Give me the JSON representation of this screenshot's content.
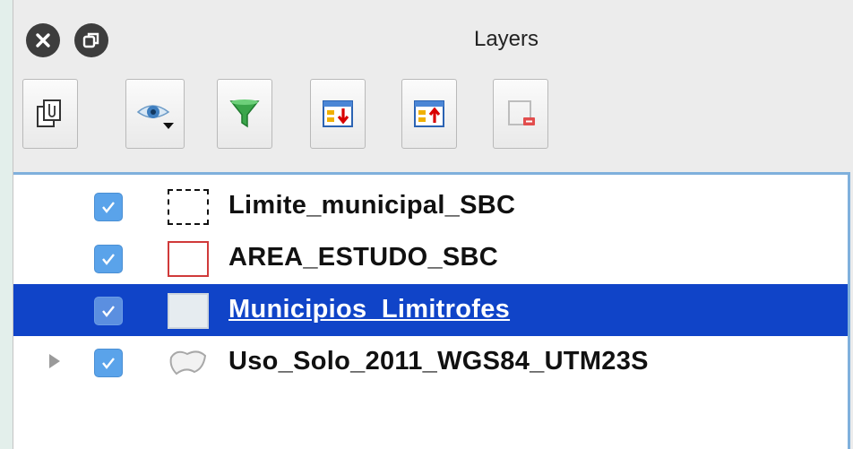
{
  "window": {
    "title": "Layers"
  },
  "toolbar": {
    "buttons": [
      {
        "name": "add-group-button",
        "icon": "add-group-icon"
      },
      {
        "name": "manage-visibility-button",
        "icon": "eye-icon"
      },
      {
        "name": "filter-legend-button",
        "icon": "funnel-icon"
      },
      {
        "name": "expand-all-button",
        "icon": "expand-all-icon"
      },
      {
        "name": "collapse-all-button",
        "icon": "collapse-all-icon"
      },
      {
        "name": "remove-layer-button",
        "icon": "remove-layer-icon"
      }
    ]
  },
  "layers": [
    {
      "label": "Limite_municipal_SBC",
      "checked": true,
      "symbol": "dashed-square",
      "expandable": false,
      "selected": false
    },
    {
      "label": "AREA_ESTUDO_SBC",
      "checked": true,
      "symbol": "red-outline-square",
      "expandable": false,
      "selected": false
    },
    {
      "label": "Municipios_Limitrofes",
      "checked": true,
      "symbol": "grey-fill-square",
      "expandable": false,
      "selected": true
    },
    {
      "label": "Uso_Solo_2011_WGS84_UTM23S",
      "checked": true,
      "symbol": "polygon-shape",
      "expandable": true,
      "selected": false
    }
  ],
  "colors": {
    "selection": "#1044c8",
    "checkbox": "#5aa3ea",
    "focus_border": "#7fb0dc"
  }
}
